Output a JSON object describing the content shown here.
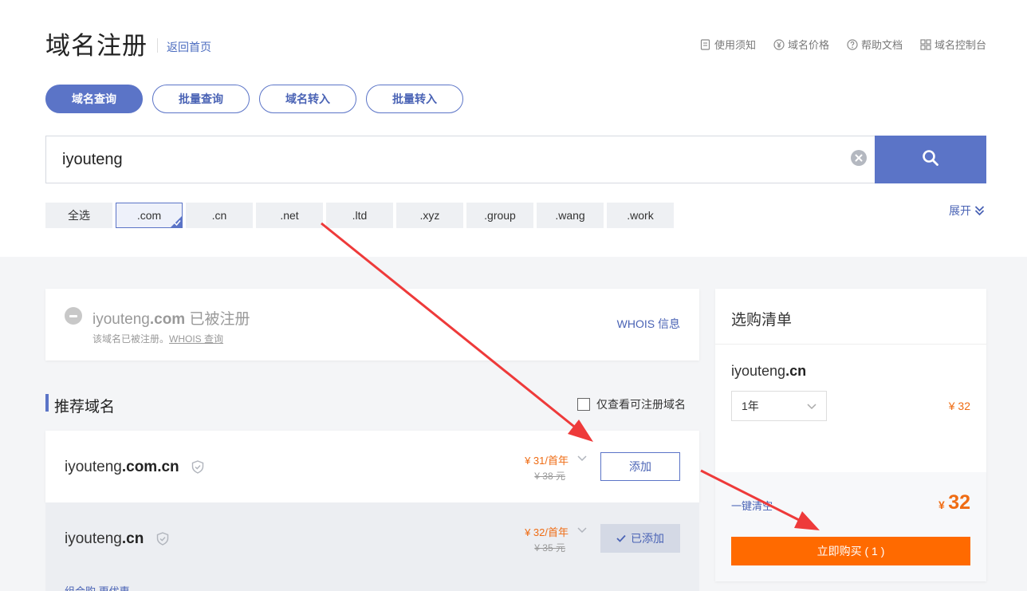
{
  "header": {
    "title": "域名注册",
    "back_link": "返回首页",
    "links": [
      {
        "label": "使用须知",
        "icon": "document-icon"
      },
      {
        "label": "域名价格",
        "icon": "yen-coin-icon"
      },
      {
        "label": "帮助文档",
        "icon": "help-circle-icon"
      },
      {
        "label": "域名控制台",
        "icon": "grid-icon"
      }
    ]
  },
  "tabs": [
    {
      "label": "域名查询",
      "active": true
    },
    {
      "label": "批量查询",
      "active": false
    },
    {
      "label": "域名转入",
      "active": false
    },
    {
      "label": "批量转入",
      "active": false
    }
  ],
  "search": {
    "value": "iyouteng"
  },
  "suffixes": {
    "select_all": "全选",
    "items": [
      ".com",
      ".cn",
      ".net",
      ".ltd",
      ".xyz",
      ".group",
      ".wang",
      ".work"
    ],
    "selected": ".com",
    "expand_label": "展开"
  },
  "taken": {
    "name": "iyouteng",
    "suffix": ".com",
    "status": "已被注册",
    "sub_text": "该域名已被注册。",
    "sub_link": "WHOIS 查询",
    "whois_link": "WHOIS 信息"
  },
  "recommend": {
    "title": "推荐域名",
    "only_available_label": "仅查看可注册域名",
    "rows": [
      {
        "name": "iyouteng",
        "suffix": ".com.cn",
        "price": "¥ 31/首年",
        "old_price": "¥ 38 元",
        "action": "添加",
        "added": false
      },
      {
        "name": "iyouteng",
        "suffix": ".cn",
        "price": "¥ 32/首年",
        "old_price": "¥ 35 元",
        "action": "已添加",
        "added": true
      }
    ],
    "combo_label": "组合购 更优惠"
  },
  "cart": {
    "title": "选购清单",
    "item": {
      "name": "iyouteng",
      "suffix": ".cn",
      "period": "1年",
      "price": "¥ 32"
    },
    "clear_label": "一键清空",
    "total_currency": "¥",
    "total_value": "32",
    "buy_label": "立即购买 ( 1 )"
  },
  "colors": {
    "primary": "#5b74c7",
    "price": "#ef6c14",
    "buy": "#ff6a00",
    "annotation_arrow": "#ee3a3a"
  }
}
